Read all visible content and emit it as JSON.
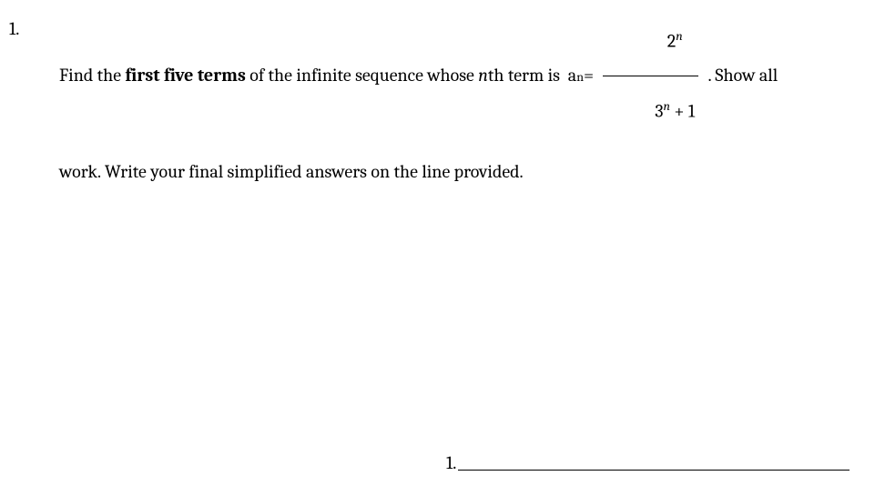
{
  "problem": {
    "number": "1.",
    "text_part1": "Find the ",
    "bold_phrase": "first five terms",
    "text_part2": " of the infinite sequence whose ",
    "nth_n": "n",
    "nth_rest": "th term is  a",
    "sub_n": "n",
    "equals": "= ",
    "frac_num_base": "2",
    "frac_num_exp": "n",
    "frac_den_base": "3",
    "frac_den_exp": "n",
    "frac_den_rest": " + 1",
    "text_part3": " . Show all",
    "text_line2": "work. Write your  final simplified answers on the line provided."
  },
  "answer": {
    "label": "1."
  }
}
